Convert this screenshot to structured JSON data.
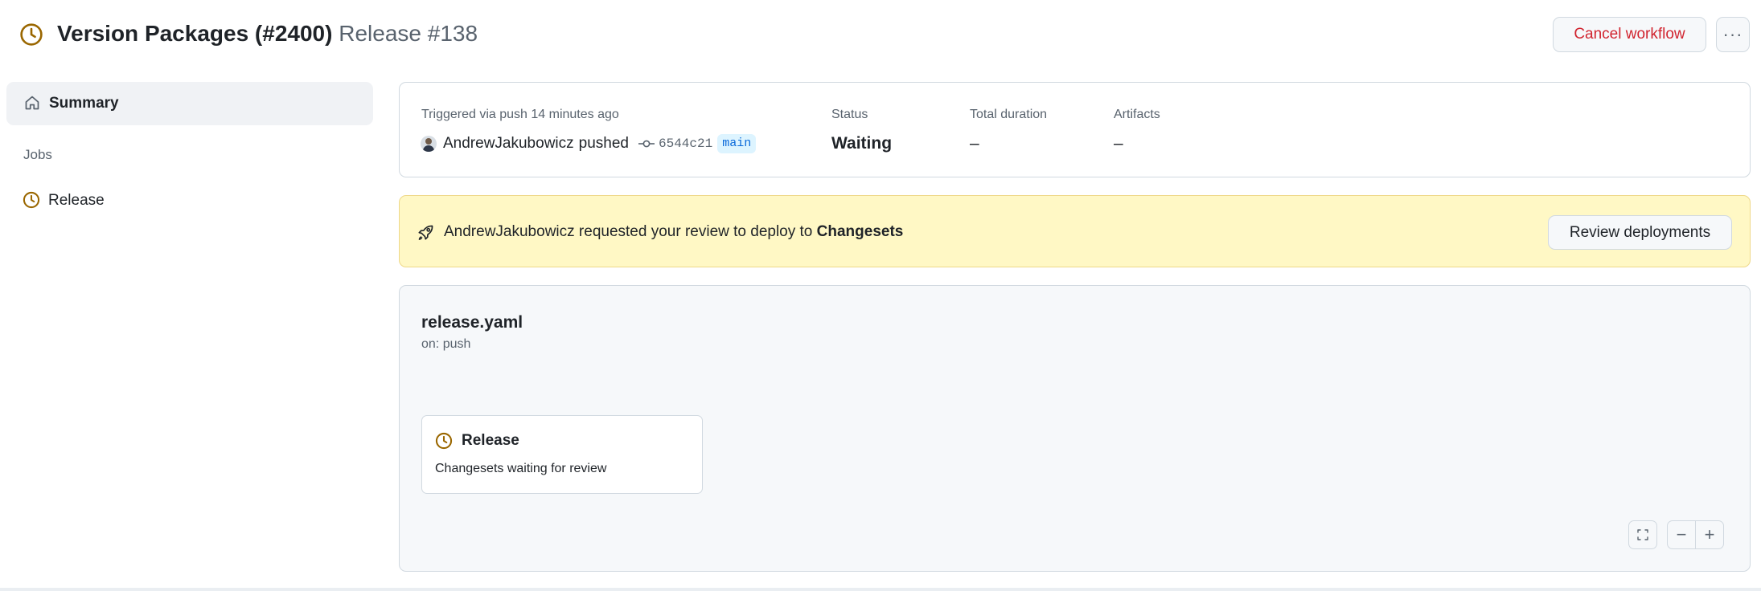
{
  "header": {
    "title_bold": "Version Packages (#2400)",
    "title_light": "Release #138",
    "status_icon": "clock-icon",
    "cancel_label": "Cancel workflow",
    "more_label": "···"
  },
  "sidebar": {
    "summary_label": "Summary",
    "summary_icon": "home-icon",
    "jobs_heading": "Jobs",
    "jobs": [
      {
        "label": "Release",
        "icon": "clock-icon"
      }
    ]
  },
  "run_summary": {
    "triggered_text": "Triggered via push 14 minutes ago",
    "actor": "AndrewJakubowicz",
    "action": "pushed",
    "commit_sha": "6544c21",
    "branch": "main",
    "status_label": "Status",
    "status_value": "Waiting",
    "duration_label": "Total duration",
    "duration_value": "–",
    "artifacts_label": "Artifacts",
    "artifacts_value": "–"
  },
  "review": {
    "actor": "AndrewJakubowicz",
    "message": "requested your review to deploy to",
    "environment": "Changesets",
    "button_label": "Review deployments"
  },
  "workflow": {
    "file_name": "release.yaml",
    "trigger": "on: push",
    "job": {
      "name": "Release",
      "status_text": "Changesets waiting for review"
    },
    "controls": {
      "zoom_out": "−",
      "zoom_in": "+"
    }
  },
  "colors": {
    "pending": "#9a6700",
    "danger": "#d1242f",
    "banner_bg": "#fff8c5",
    "branch_bg": "#ddf4ff",
    "branch_fg": "#0969da"
  }
}
